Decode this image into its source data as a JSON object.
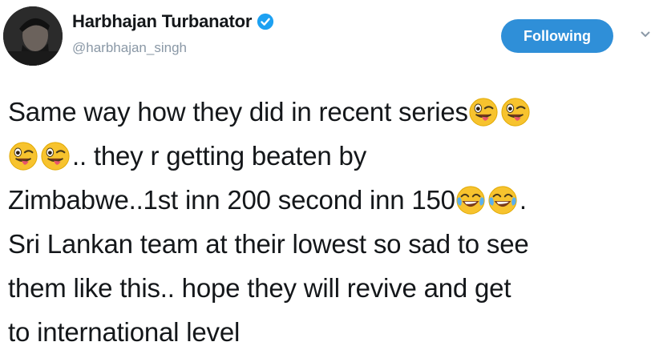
{
  "author": {
    "display_name": "Harbhajan Turbanator",
    "handle": "@harbhajan_singh",
    "verified": true
  },
  "follow_button": {
    "label": "Following"
  },
  "tweet": {
    "lines": [
      {
        "text": "Same way how they did in recent series",
        "trailing_emojis": [
          "winking-tongue-emoji",
          "winking-tongue-emoji"
        ]
      },
      {
        "leading_emojis": [
          "winking-tongue-emoji",
          "winking-tongue-emoji"
        ],
        "text": ".. they r getting beaten by"
      },
      {
        "text": "Zimbabwe..1st inn 200 second inn 150",
        "trailing_emojis": [
          "tears-of-joy-emoji",
          "tears-of-joy-emoji"
        ],
        "suffix": "."
      },
      {
        "text": "Sri Lankan team at their lowest so sad to see"
      },
      {
        "text": "them like this.. hope they will revive and get"
      },
      {
        "text": "to international level"
      }
    ]
  },
  "colors": {
    "accent": "#2f8fd8",
    "name": "#14171a",
    "handle": "#8a98a6",
    "verified": "#1da1f2"
  }
}
